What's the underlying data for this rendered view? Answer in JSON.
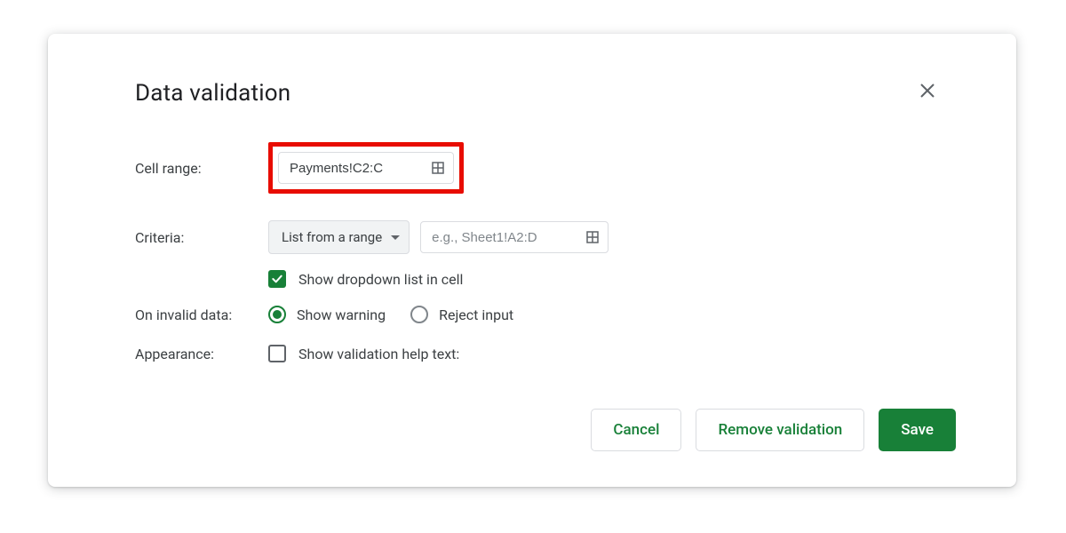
{
  "dialog": {
    "title": "Data validation",
    "cell_range": {
      "label": "Cell range:",
      "value": "Payments!C2:C"
    },
    "criteria": {
      "label": "Criteria:",
      "dropdown_value": "List from a range",
      "range_placeholder": "e.g., Sheet1!A2:D",
      "show_dropdown_label": "Show dropdown list in cell"
    },
    "on_invalid": {
      "label": "On invalid data:",
      "show_warning": "Show warning",
      "reject_input": "Reject input"
    },
    "appearance": {
      "label": "Appearance:",
      "help_text_label": "Show validation help text:"
    },
    "buttons": {
      "cancel": "Cancel",
      "remove": "Remove validation",
      "save": "Save"
    }
  }
}
